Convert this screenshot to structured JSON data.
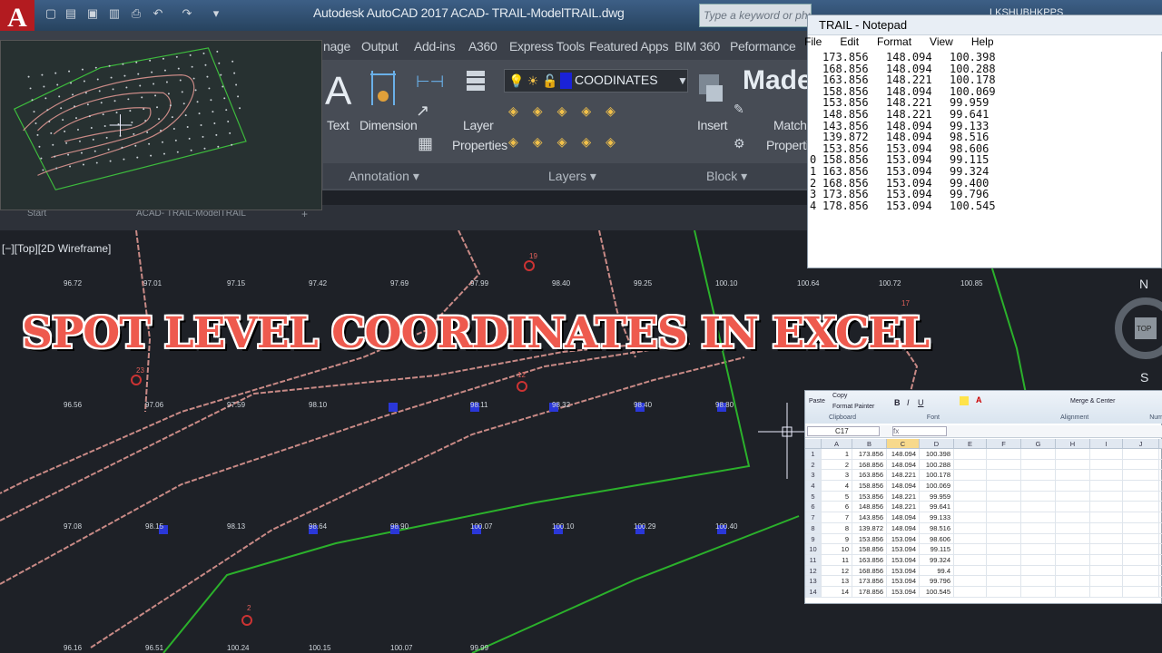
{
  "app": {
    "logo": "A",
    "title": "Autodesk AutoCAD 2017     ACAD- TRAIL-ModelTRAIL.dwg",
    "search_placeholder": "Type a keyword or phrase",
    "user": "LKSHUBHKPPS"
  },
  "ribbon": {
    "tabs": [
      "nage",
      "Output",
      "Add-ins",
      "A360",
      "Express Tools",
      "Featured Apps",
      "BIM 360",
      "Peformance"
    ],
    "buttons": {
      "text": "Text",
      "dimension": "Dimension",
      "layer_properties_1": "Layer",
      "layer_properties_2": "Properties",
      "insert": "Insert",
      "match_1": "Match",
      "match_2": "Propertie",
      "made": "Made"
    },
    "layer_combo_value": "COODINATES",
    "panels": {
      "annotation": "Annotation ▾",
      "layers": "Layers ▾",
      "block": "Block ▾"
    },
    "colors": {
      "layer_swatch": "#1a22d8",
      "logo": "#b31b20"
    }
  },
  "filetabs": [
    "Start",
    "ACAD- TRAIL-ModelTRAIL"
  ],
  "viewport": {
    "label": "[−][Top][2D Wireframe]",
    "row1_levels": [
      "96.72",
      "97.01",
      "97.15",
      "97.42",
      "97.69",
      "97.99",
      "98.40",
      "99.25",
      "100.10",
      "100.64",
      "100.72",
      "100.85"
    ],
    "row2_levels": [
      "96.56",
      "97.06",
      "97.59",
      "98.10",
      "",
      "98.11",
      "98.32",
      "98.40",
      "98.80"
    ],
    "row3_levels": [
      "97.08",
      "98.15",
      "98.13",
      "98.64",
      "98.90",
      "100.07",
      "100.10",
      "100.29",
      "100.40"
    ],
    "row4_levels": [
      "96.16",
      "96.51",
      "100.24",
      "100.15",
      "100.07",
      "99.99"
    ],
    "point_labels": [
      "19",
      "23",
      "12",
      "17",
      "2"
    ],
    "compass": {
      "n": "N",
      "top": "TOP",
      "s": "S"
    }
  },
  "headline": "SPOT LEVEL   COORDINATES IN EXCEL",
  "notepad": {
    "title": "TRAIL - Notepad",
    "menu": [
      "File",
      "Edit",
      "Format",
      "View",
      "Help"
    ],
    "rows": [
      [
        "",
        "173.856",
        "148.094",
        "100.398"
      ],
      [
        "",
        "168.856",
        "148.094",
        "100.288"
      ],
      [
        "",
        "163.856",
        "148.221",
        "100.178"
      ],
      [
        "",
        "158.856",
        "148.094",
        "100.069"
      ],
      [
        "",
        "153.856",
        "148.221",
        "99.959"
      ],
      [
        "",
        "148.856",
        "148.221",
        "99.641"
      ],
      [
        "",
        "143.856",
        "148.094",
        "99.133"
      ],
      [
        "",
        "139.872",
        "148.094",
        "98.516"
      ],
      [
        "",
        "153.856",
        "153.094",
        "98.606"
      ],
      [
        "0",
        "158.856",
        "153.094",
        "99.115"
      ],
      [
        "1",
        "163.856",
        "153.094",
        "99.324"
      ],
      [
        "2",
        "168.856",
        "153.094",
        "99.400"
      ],
      [
        "3",
        "173.856",
        "153.094",
        "99.796"
      ],
      [
        "4",
        "178.856",
        "153.094",
        "100.545"
      ]
    ]
  },
  "excel": {
    "groups": [
      "Clipboard",
      "Font",
      "Alignment",
      "Num"
    ],
    "clipboard": {
      "paste": "Paste",
      "copy": "Copy",
      "format_painter": "Format Painter"
    },
    "merge_center": "Merge & Center",
    "name_box": "C17",
    "columns": [
      "A",
      "B",
      "C",
      "D",
      "E",
      "F",
      "G",
      "H",
      "I",
      "J"
    ],
    "rows": [
      [
        "1",
        "1",
        "173.856",
        "148.094",
        "100.398"
      ],
      [
        "2",
        "2",
        "168.856",
        "148.094",
        "100.288"
      ],
      [
        "3",
        "3",
        "163.856",
        "148.221",
        "100.178"
      ],
      [
        "4",
        "4",
        "158.856",
        "148.094",
        "100.069"
      ],
      [
        "5",
        "5",
        "153.856",
        "148.221",
        "99.959"
      ],
      [
        "6",
        "6",
        "148.856",
        "148.221",
        "99.641"
      ],
      [
        "7",
        "7",
        "143.856",
        "148.094",
        "99.133"
      ],
      [
        "8",
        "8",
        "139.872",
        "148.094",
        "98.516"
      ],
      [
        "9",
        "9",
        "153.856",
        "153.094",
        "98.606"
      ],
      [
        "10",
        "10",
        "158.856",
        "153.094",
        "99.115"
      ],
      [
        "11",
        "11",
        "163.856",
        "153.094",
        "99.324"
      ],
      [
        "12",
        "12",
        "168.856",
        "153.094",
        "99.4"
      ],
      [
        "13",
        "13",
        "173.856",
        "153.094",
        "99.796"
      ],
      [
        "14",
        "14",
        "178.856",
        "153.094",
        "100.545"
      ]
    ]
  }
}
